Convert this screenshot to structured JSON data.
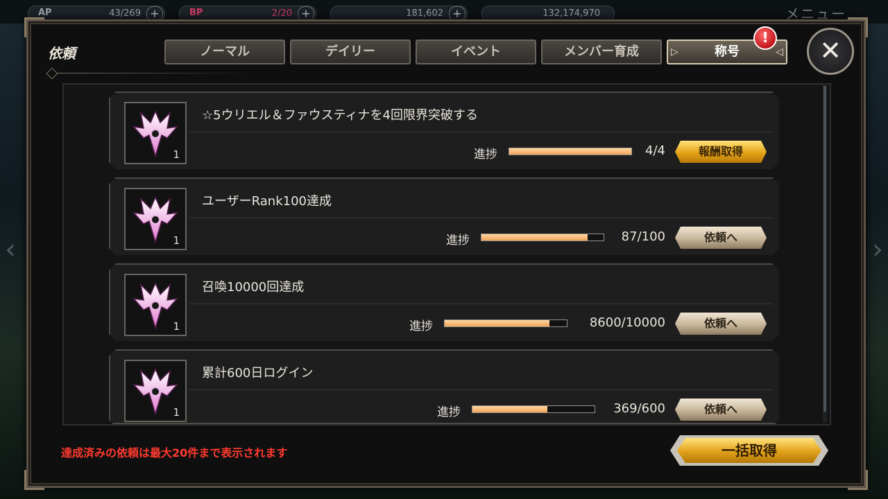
{
  "topbar": {
    "ap": {
      "label": "AP",
      "value": "43/269"
    },
    "bp": {
      "label": "BP",
      "value": "2/20"
    },
    "gold": {
      "value": "181,602"
    },
    "coin": {
      "value": "132,174,970"
    },
    "menu_label": "メニュー"
  },
  "dialog": {
    "title": "依頼",
    "tabs": [
      "ノーマル",
      "デイリー",
      "イベント",
      "メンバー育成",
      "称号"
    ],
    "active_tab": 4,
    "badge": "!",
    "close_symbol": "✕"
  },
  "items": [
    {
      "name": "☆5ウリエル＆ファウスティナを4回限界突破する",
      "count": "1",
      "progress_label": "進捗",
      "progress_text": "4/4",
      "progress": 1.0,
      "button": "報酬取得",
      "button_style": "gold"
    },
    {
      "name": "ユーザーRank100達成",
      "count": "1",
      "progress_label": "進捗",
      "progress_text": "87/100",
      "progress": 0.87,
      "button": "依頼へ",
      "button_style": "beige"
    },
    {
      "name": "召喚10000回達成",
      "count": "1",
      "progress_label": "進捗",
      "progress_text": "8600/10000",
      "progress": 0.86,
      "button": "依頼へ",
      "button_style": "beige"
    },
    {
      "name": "累計600日ログイン",
      "count": "1",
      "progress_label": "進捗",
      "progress_text": "369/600",
      "progress": 0.615,
      "button": "依頼へ",
      "button_style": "beige"
    }
  ],
  "footer": {
    "note": "達成済みの依頼は最大20件まで表示されます",
    "claim_all": "一括取得"
  },
  "colors": {
    "accent_gold": "#e5a316",
    "note_red": "#ff3a2f",
    "progress_fill": "#f0a35a"
  }
}
